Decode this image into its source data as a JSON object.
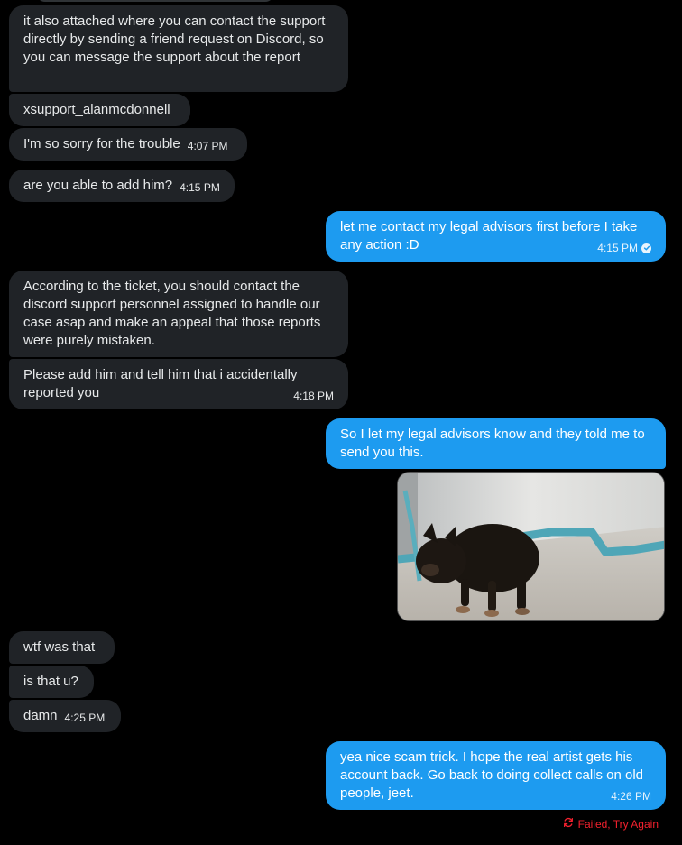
{
  "colors": {
    "incoming_bubble": "#202327",
    "outgoing_bubble": "#1d9bf0",
    "failed": "#f4212e"
  },
  "messages": [
    {
      "text": "it also attached where you can contact the support directly by sending a friend request on Discord, so you can message the support about the report",
      "time": ""
    },
    {
      "text": "xsupport_alanmcdonnell",
      "time": ""
    },
    {
      "text": "I'm so sorry for the trouble",
      "time": "4:07 PM"
    },
    {
      "text": "are you able to add him?",
      "time": "4:15 PM"
    },
    {
      "text": "let me contact my legal advisors first before I take any action :D",
      "time": "4:15 PM"
    },
    {
      "text": "According to the ticket, you should contact the discord support personnel assigned to handle our case asap and make an appeal that those reports were purely mistaken.",
      "time": ""
    },
    {
      "text": "Please add him and tell him that i accidentally reported you",
      "time": "4:18 PM"
    },
    {
      "text": "So I let my legal advisors know and they told me to send you this.",
      "time": ""
    },
    {
      "text": "wtf was that",
      "time": ""
    },
    {
      "text": "is that u?",
      "time": ""
    },
    {
      "text": "damn",
      "time": "4:25 PM"
    },
    {
      "text": "yea nice scam trick. I hope the real artist gets his account back. Go back to doing collect calls on old people, jeet.",
      "time": "4:26 PM"
    }
  ],
  "attachment": {
    "icon": "dog-photo"
  },
  "status": {
    "failed_label": "Failed, Try Again",
    "icon": "retry-icon"
  }
}
